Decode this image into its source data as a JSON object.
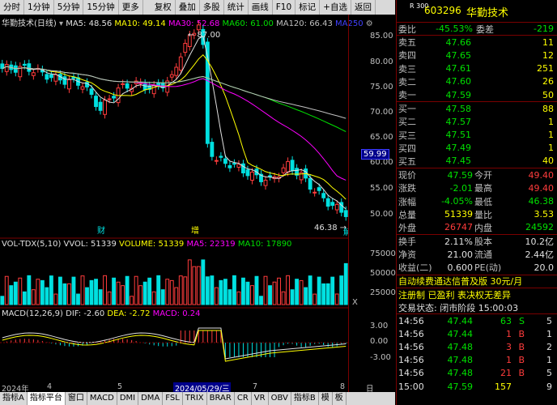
{
  "toolbar": {
    "items": [
      "分时",
      "1分钟",
      "5分钟",
      "15分钟",
      "更多",
      "复权",
      "叠加",
      "多股",
      "统计",
      "画线",
      "F10",
      "标记",
      "+自选",
      "返回"
    ]
  },
  "legend": {
    "title": "华勤技术(日线)",
    "ma5": "MA5: 48.56",
    "ma10": "MA10: 49.14",
    "ma30": "MA30: 52.68",
    "ma60": "MA60: 61.00",
    "ma120": "MA120: 66.43",
    "ma250": "MA250"
  },
  "vol_legend": {
    "title": "VOL-TDX(5,10)",
    "vol": "VVOL: 51339",
    "volume": "VOLUME: 51339",
    "ma5": "MA5: 22319",
    "ma10": "MA10: 17890"
  },
  "macd_legend": {
    "title": "MACD(12,26,9)",
    "dif": "DIF: -2.60",
    "dea": "DEA: -2.72",
    "macd": "MACD: 0.24"
  },
  "price_axis": [
    "85.00",
    "80.00",
    "75.00",
    "70.00",
    "65.00",
    "60.00",
    "55.00",
    "50.00"
  ],
  "current_price": "59.99",
  "vol_axis": [
    "75000",
    "50000",
    "25000"
  ],
  "vol_axis_unit": "X",
  "macd_axis": [
    "3.00",
    "0.00",
    "-3.00"
  ],
  "annotations": {
    "high": "87.00",
    "low": "46.38",
    "cai": "财",
    "zeng": "增",
    "jie": "解"
  },
  "dates": {
    "d1": "2024年",
    "d2": "4",
    "d3": "5",
    "d4": "2024/05/29/三",
    "d5": "7",
    "d6": "8",
    "period": "日线"
  },
  "bottom": [
    "指标A",
    "指标平台",
    "窗口",
    "MACD",
    "DMI",
    "DMA",
    "FSL",
    "TRIX",
    "BRAR",
    "CR",
    "VR",
    "OBV",
    "指标B",
    "模",
    "板"
  ],
  "quote": {
    "code_small": "R 300",
    "code": "603296",
    "name": "华勤技术",
    "weibi_label": "委比",
    "weibi": "-45.53%",
    "weicha_label": "委差",
    "weicha": "-219",
    "asks": [
      {
        "l": "卖五",
        "p": "47.66",
        "v": "11"
      },
      {
        "l": "卖四",
        "p": "47.65",
        "v": "12"
      },
      {
        "l": "卖三",
        "p": "47.61",
        "v": "251"
      },
      {
        "l": "卖二",
        "p": "47.60",
        "v": "26"
      },
      {
        "l": "卖一",
        "p": "47.59",
        "v": "50"
      }
    ],
    "bids": [
      {
        "l": "买一",
        "p": "47.58",
        "v": "88"
      },
      {
        "l": "买二",
        "p": "47.57",
        "v": "1"
      },
      {
        "l": "买三",
        "p": "47.51",
        "v": "1"
      },
      {
        "l": "买四",
        "p": "47.49",
        "v": "1"
      },
      {
        "l": "买五",
        "p": "47.45",
        "v": "40"
      }
    ],
    "stats": [
      {
        "l1": "现价",
        "v1": "47.59",
        "c1": "grn",
        "l2": "今开",
        "v2": "49.40",
        "c2": "red"
      },
      {
        "l1": "涨跌",
        "v1": "-2.01",
        "c1": "grn",
        "l2": "最高",
        "v2": "49.40",
        "c2": "red"
      },
      {
        "l1": "涨幅",
        "v1": "-4.05%",
        "c1": "grn",
        "l2": "最低",
        "v2": "46.38",
        "c2": "grn"
      },
      {
        "l1": "总量",
        "v1": "51339",
        "c1": "yel",
        "l2": "量比",
        "v2": "3.53",
        "c2": "yel"
      },
      {
        "l1": "外盘",
        "v1": "26747",
        "c1": "red",
        "l2": "内盘",
        "v2": "24592",
        "c2": "grn"
      }
    ],
    "stats2": [
      {
        "l1": "换手",
        "v1": "2.11%",
        "l2": "股本",
        "v2": "10.2亿"
      },
      {
        "l1": "净资",
        "v1": "21.00",
        "l2": "流通",
        "v2": "2.44亿"
      },
      {
        "l1": "收益(二)",
        "v1": "0.600",
        "l2": "PE(动)",
        "v2": "20.0"
      }
    ],
    "ad": "自动续费通达信普及版  30元/月",
    "notice": "注册制 已盈利 表决权无差异",
    "status": "交易状态: 闭市阶段 15:00:03",
    "ticks": [
      {
        "t": "14:56",
        "p": "47.44",
        "v": "63",
        "d": "S",
        "n": "5"
      },
      {
        "t": "14:56",
        "p": "47.44",
        "v": "1",
        "d": "B",
        "n": "1"
      },
      {
        "t": "14:56",
        "p": "47.48",
        "v": "3",
        "d": "B",
        "n": "2"
      },
      {
        "t": "14:56",
        "p": "47.48",
        "v": "1",
        "d": "B",
        "n": "1"
      },
      {
        "t": "14:56",
        "p": "47.48",
        "v": "21",
        "d": "B",
        "n": "5"
      },
      {
        "t": "15:00",
        "p": "47.59",
        "v": "157",
        "d": "",
        "n": "9"
      }
    ]
  }
}
